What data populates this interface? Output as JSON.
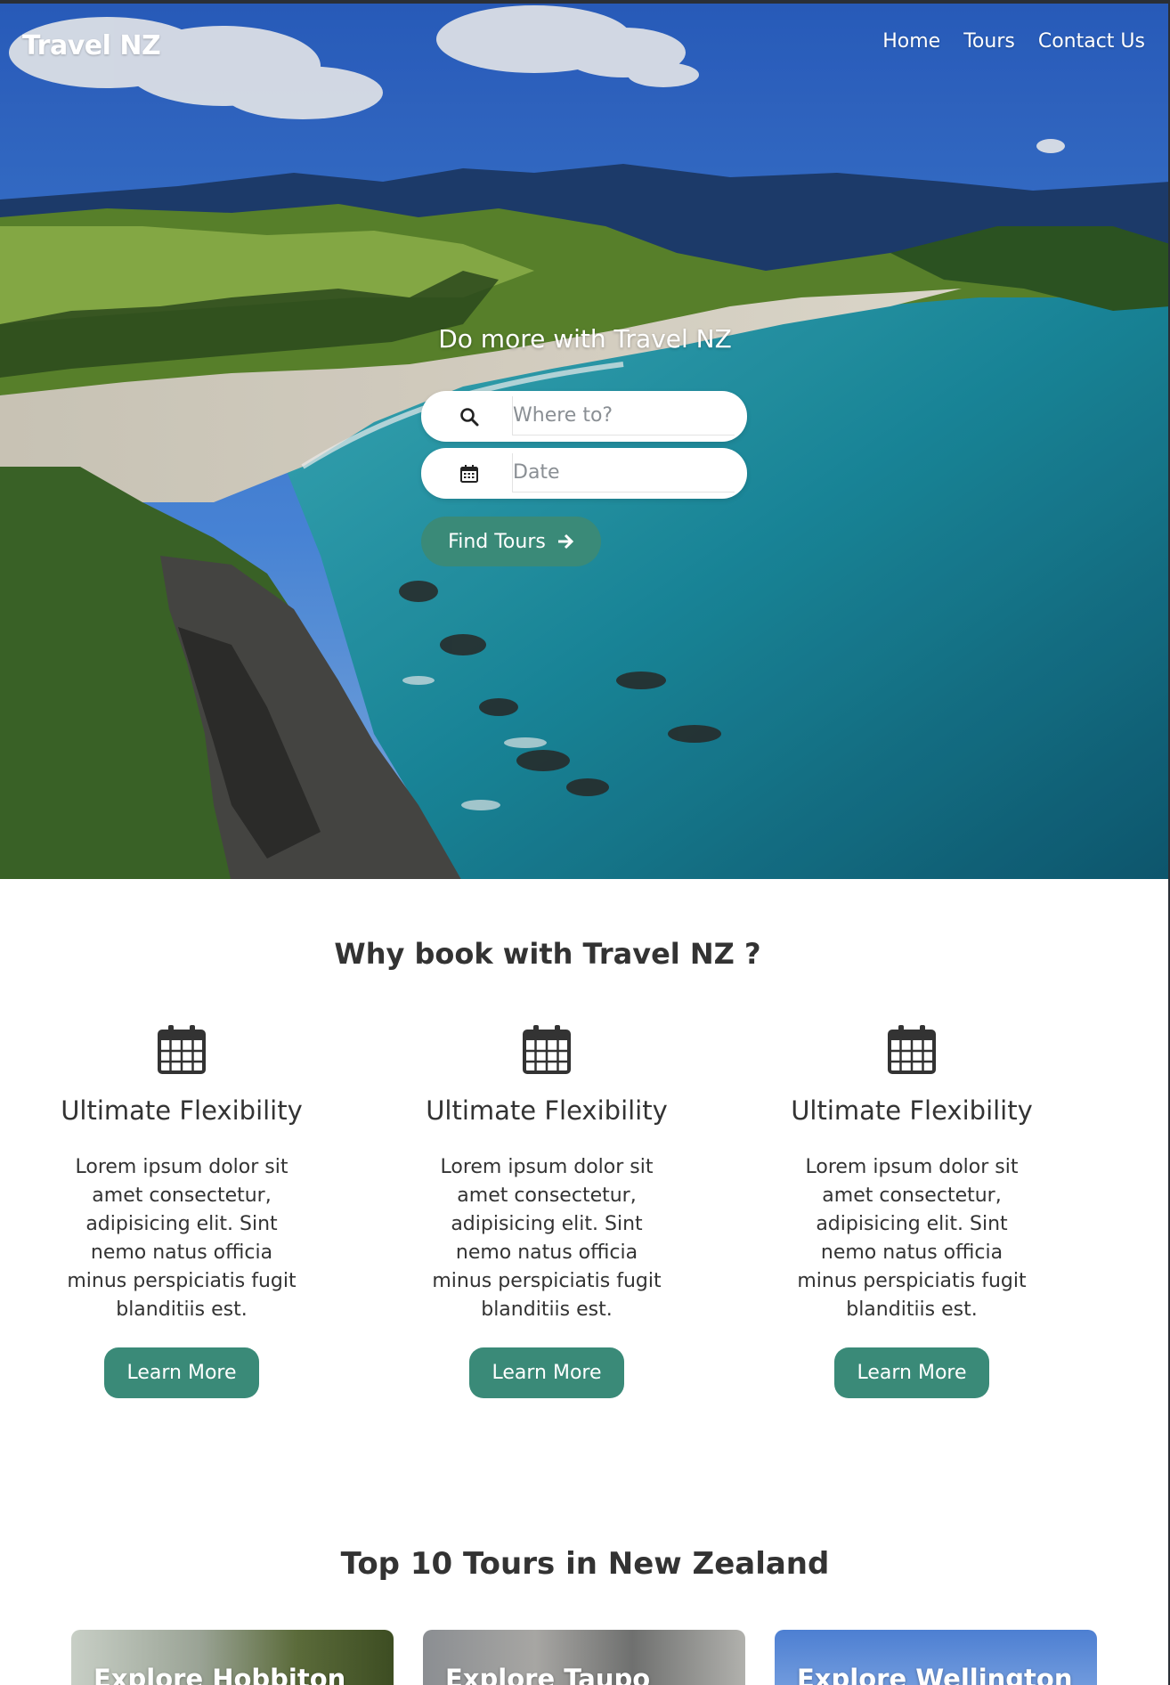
{
  "header": {
    "brand": "Travel NZ",
    "nav": [
      {
        "label": "Home"
      },
      {
        "label": "Tours"
      },
      {
        "label": "Contact Us"
      }
    ]
  },
  "hero": {
    "title": "Do more with Travel NZ",
    "search": {
      "where_placeholder": "Where to?",
      "where_icon": "search-icon",
      "date_placeholder": "Date",
      "date_icon": "calendar-icon"
    },
    "cta_label": "Find Tours",
    "cta_icon": "arrow-right-icon"
  },
  "why": {
    "title": "Why book with Travel NZ ?",
    "features": [
      {
        "icon": "calendar-icon",
        "title": "Ultimate Flexibility",
        "text": "Lorem ipsum dolor sit amet consectetur, adipisicing elit. Sint nemo natus officia minus perspiciatis fugit blanditiis est.",
        "button": "Learn More"
      },
      {
        "icon": "calendar-icon",
        "title": "Ultimate Flexibility",
        "text": "Lorem ipsum dolor sit amet consectetur, adipisicing elit. Sint nemo natus officia minus perspiciatis fugit blanditiis est.",
        "button": "Learn More"
      },
      {
        "icon": "calendar-icon",
        "title": "Ultimate Flexibility",
        "text": "Lorem ipsum dolor sit amet consectetur, adipisicing elit. Sint nemo natus officia minus perspiciatis fugit blanditiis est.",
        "button": "Learn More"
      }
    ]
  },
  "tours": {
    "title": "Top 10 Tours in New Zealand",
    "cards": [
      {
        "label": "Explore Hobbiton"
      },
      {
        "label": "Explore Taupo"
      },
      {
        "label": "Explore Wellington"
      }
    ]
  },
  "colors": {
    "accent": "#3a8a78",
    "text": "#333333",
    "background": "#ffffff"
  }
}
